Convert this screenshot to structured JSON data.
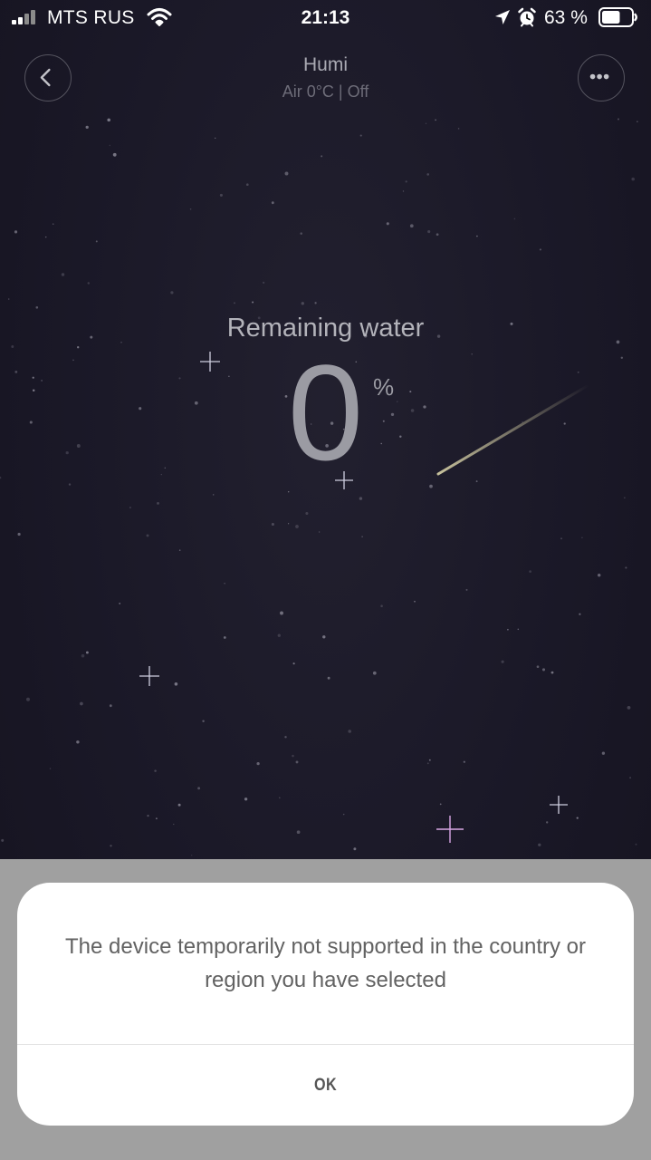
{
  "status_bar": {
    "carrier": "MTS RUS",
    "time": "21:13",
    "battery_percent": "63 %",
    "battery_level": 0.63,
    "icons": [
      "signal-icon",
      "wifi-icon",
      "location-icon",
      "alarm-icon",
      "battery-icon"
    ]
  },
  "header": {
    "title": "Humi",
    "subtitle": "Air 0°C | Off",
    "back_icon": "chevron-left-icon",
    "more_icon": "more-dots-icon"
  },
  "main": {
    "label": "Remaining water",
    "value": "0",
    "unit": "%"
  },
  "dialog": {
    "message": "The device temporarily not supported in the country or region you have selected",
    "ok_label": "OK"
  },
  "colors": {
    "background": "#1b1828",
    "dialog_bg": "#ffffff",
    "overlay": "#a0a0a0",
    "text_muted": "#9b9ba3"
  }
}
